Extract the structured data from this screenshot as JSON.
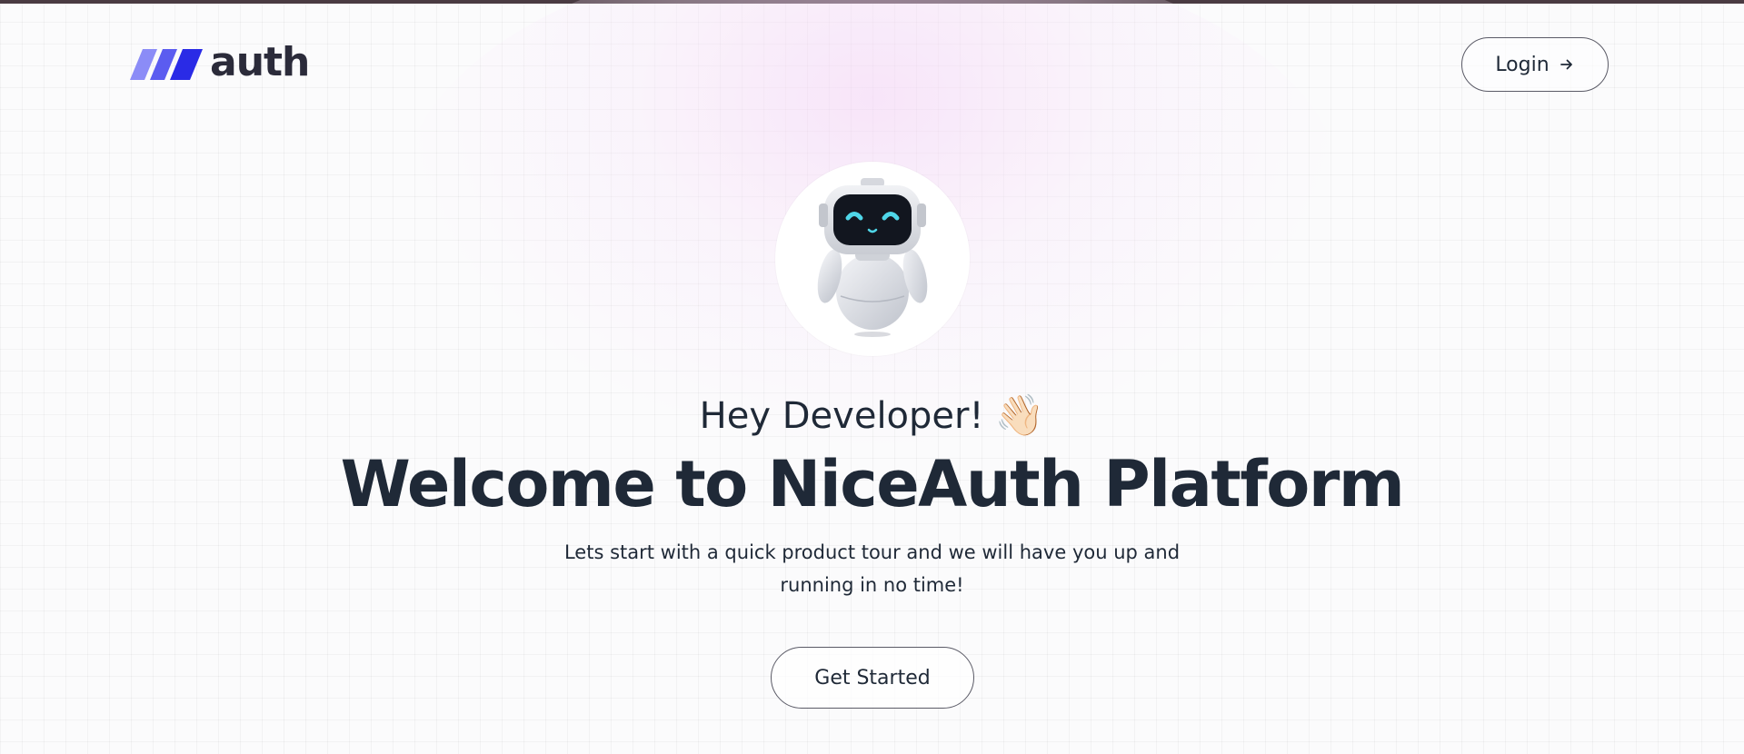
{
  "header": {
    "logo_text": "auth",
    "login_label": "Login"
  },
  "hero": {
    "greeting": "Hey Developer!",
    "greeting_emoji": "👋🏻",
    "title": "Welcome to NiceAuth Platform",
    "subtitle": "Lets start with a quick product tour and we will have you up and running in no time!",
    "cta_label": "Get Started"
  },
  "icons": {
    "logo": "logo-slashes-icon",
    "login_arrow": "arrow-right-icon",
    "mascot": "robot-mascot-icon",
    "wave": "waving-hand-icon"
  },
  "colors": {
    "brand_light": "#8b8cf7",
    "brand_mid": "#5b5cf0",
    "brand_dark": "#2a2be6",
    "text": "#1f2937",
    "top_bar": "#4a3b42",
    "robot_eyes": "#4fd6e8"
  }
}
